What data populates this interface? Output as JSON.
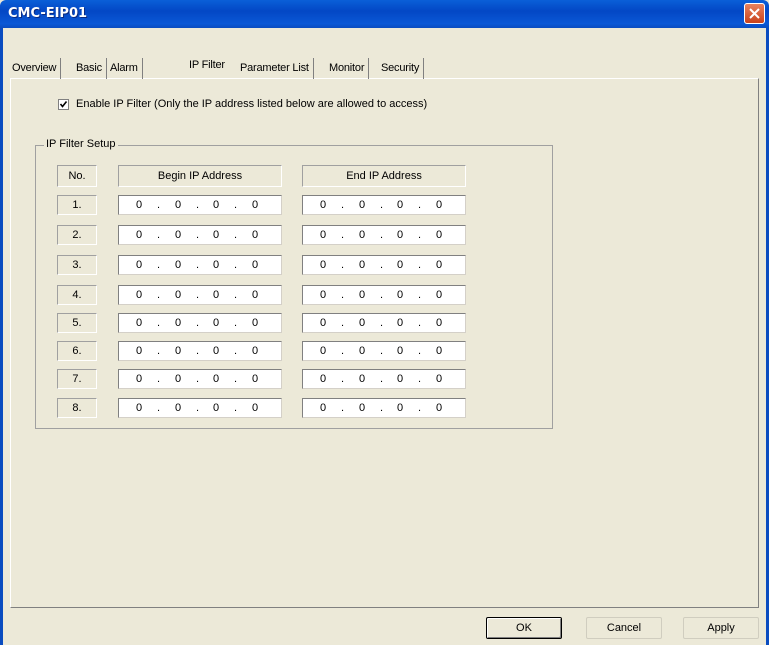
{
  "window": {
    "title": "CMC-EIP01"
  },
  "tabs": [
    {
      "label": "Overview"
    },
    {
      "label": "Basic"
    },
    {
      "label": "Alarm"
    },
    {
      "label": "IP Filter"
    },
    {
      "label": "Parameter List"
    },
    {
      "label": "Monitor"
    },
    {
      "label": "Security"
    }
  ],
  "active_tab": "IP Filter",
  "enable_filter": {
    "checked": true,
    "label": "Enable IP Filter  (Only the IP address listed below are allowed to access)"
  },
  "group": {
    "label": "IP Filter Setup",
    "headers": {
      "no": "No.",
      "begin": "Begin IP Address",
      "end": "End IP Address"
    },
    "rows": [
      {
        "no": "1.",
        "begin": [
          "0",
          "0",
          "0",
          "0"
        ],
        "end": [
          "0",
          "0",
          "0",
          "0"
        ]
      },
      {
        "no": "2.",
        "begin": [
          "0",
          "0",
          "0",
          "0"
        ],
        "end": [
          "0",
          "0",
          "0",
          "0"
        ]
      },
      {
        "no": "3.",
        "begin": [
          "0",
          "0",
          "0",
          "0"
        ],
        "end": [
          "0",
          "0",
          "0",
          "0"
        ]
      },
      {
        "no": "4.",
        "begin": [
          "0",
          "0",
          "0",
          "0"
        ],
        "end": [
          "0",
          "0",
          "0",
          "0"
        ]
      },
      {
        "no": "5.",
        "begin": [
          "0",
          "0",
          "0",
          "0"
        ],
        "end": [
          "0",
          "0",
          "0",
          "0"
        ]
      },
      {
        "no": "6.",
        "begin": [
          "0",
          "0",
          "0",
          "0"
        ],
        "end": [
          "0",
          "0",
          "0",
          "0"
        ]
      },
      {
        "no": "7.",
        "begin": [
          "0",
          "0",
          "0",
          "0"
        ],
        "end": [
          "0",
          "0",
          "0",
          "0"
        ]
      },
      {
        "no": "8.",
        "begin": [
          "0",
          "0",
          "0",
          "0"
        ],
        "end": [
          "0",
          "0",
          "0",
          "0"
        ]
      }
    ]
  },
  "buttons": {
    "ok": "OK",
    "cancel": "Cancel",
    "apply": "Apply"
  }
}
